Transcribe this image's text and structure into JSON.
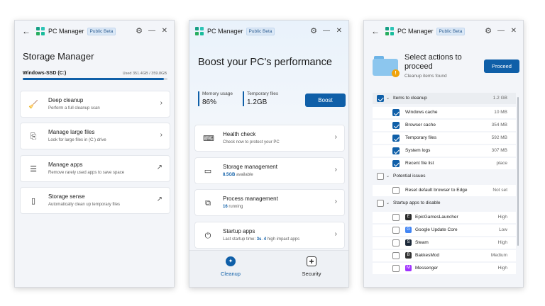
{
  "app": {
    "name": "PC Manager",
    "badge": "Public Beta",
    "back_glyph": "←",
    "gear_glyph": "⚙",
    "min_glyph": "—",
    "close_glyph": "✕"
  },
  "storage": {
    "title": "Storage Manager",
    "drive": "Windows-SSD (C:)",
    "used_text": "Used 351.4GB / 359.8GB",
    "used_fraction": 0.977,
    "items": [
      {
        "title": "Deep cleanup",
        "sub": "Perform a full cleanup scan",
        "icon": "broom-icon",
        "glyph": "🧹",
        "action": "›"
      },
      {
        "title": "Manage large files",
        "sub": "Look for large files in (C:) drive",
        "icon": "large-files-icon",
        "glyph": "⎘",
        "action": "›"
      },
      {
        "title": "Manage apps",
        "sub": "Remove rarely used apps to save space",
        "icon": "apps-list-icon",
        "glyph": "☰",
        "action": "↗"
      },
      {
        "title": "Storage sense",
        "sub": "Automatically clean up temporary files",
        "icon": "storage-sense-icon",
        "glyph": "▯",
        "action": "↗"
      }
    ]
  },
  "boost": {
    "title": "Boost your PC's performance",
    "memory_label": "Memory usage",
    "memory_value": "86%",
    "temp_label": "Temporary files",
    "temp_value": "1.2GB",
    "button": "Boost",
    "cards": [
      {
        "title": "Health check",
        "sub": "Check now to protect your PC",
        "icon": "health-check-icon",
        "glyph": "⌨"
      },
      {
        "title": "Storage management",
        "sub_bold": "8.5GB",
        "sub_rest": " available",
        "icon": "storage-drive-icon",
        "glyph": "▭"
      },
      {
        "title": "Process management",
        "sub_bold": "16",
        "sub_rest": " running",
        "icon": "process-icon",
        "glyph": "⧉"
      },
      {
        "title": "Startup apps",
        "sub_pre": "Last startup time: ",
        "sub_bold1": "3s",
        "sub_mid": ". ",
        "sub_bold2": "4",
        "sub_rest": " high impact apps",
        "icon": "power-icon",
        "glyph": "⏻"
      }
    ],
    "nav": [
      {
        "label": "Cleanup",
        "icon": "cleanup-nav-icon",
        "glyph": "✦",
        "active": true
      },
      {
        "label": "Security",
        "icon": "security-shield-icon",
        "glyph": "✚",
        "active": false
      }
    ],
    "chevron": "›"
  },
  "cleanup": {
    "title": "Select actions to proceed",
    "sub": "Cleanup items found",
    "button": "Proceed",
    "warn_glyph": "!",
    "rows": [
      {
        "kind": "hdr",
        "label": "Items to cleanup",
        "value": "1.2 GB",
        "checked": true,
        "arrow": "⌄"
      },
      {
        "kind": "sub",
        "label": "Windows cache",
        "value": "10 MB",
        "checked": true
      },
      {
        "kind": "sub",
        "label": "Browser cache",
        "value": "354 MB",
        "checked": true
      },
      {
        "kind": "sub",
        "label": "Temporary files",
        "value": "592 MB",
        "checked": true
      },
      {
        "kind": "sub",
        "label": "System logs",
        "value": "307 MB",
        "checked": true
      },
      {
        "kind": "sub",
        "label": "Recent file list",
        "value": "place",
        "checked": true
      },
      {
        "kind": "hdr",
        "label": "Potential issues",
        "value": "",
        "checked": false,
        "arrow": "⌄"
      },
      {
        "kind": "sub",
        "label": "Reset default browser to Edge",
        "value": "Not set",
        "checked": false
      },
      {
        "kind": "hdr",
        "label": "Startup apps to disable",
        "value": "",
        "checked": false,
        "arrow": "⌄"
      },
      {
        "kind": "app",
        "label": "EpicGamesLauncher",
        "value": "High",
        "checked": false,
        "color": "#2a2a2a",
        "glyph": "E"
      },
      {
        "kind": "app",
        "label": "Google Update Core",
        "value": "Low",
        "checked": false,
        "color": "#4285f4",
        "glyph": "G"
      },
      {
        "kind": "app",
        "label": "Steam",
        "value": "High",
        "checked": false,
        "color": "#1b2838",
        "glyph": "S"
      },
      {
        "kind": "app",
        "label": "BakkesMod",
        "value": "Medium",
        "checked": false,
        "color": "#333333",
        "glyph": "B"
      },
      {
        "kind": "app",
        "label": "Messenger",
        "value": "High",
        "checked": false,
        "color": "#a033ff",
        "glyph": "M"
      }
    ]
  },
  "colors": {
    "accent": "#0f5fa8",
    "badge_bg": "#dbe8f6",
    "warning": "#f0a30a"
  }
}
